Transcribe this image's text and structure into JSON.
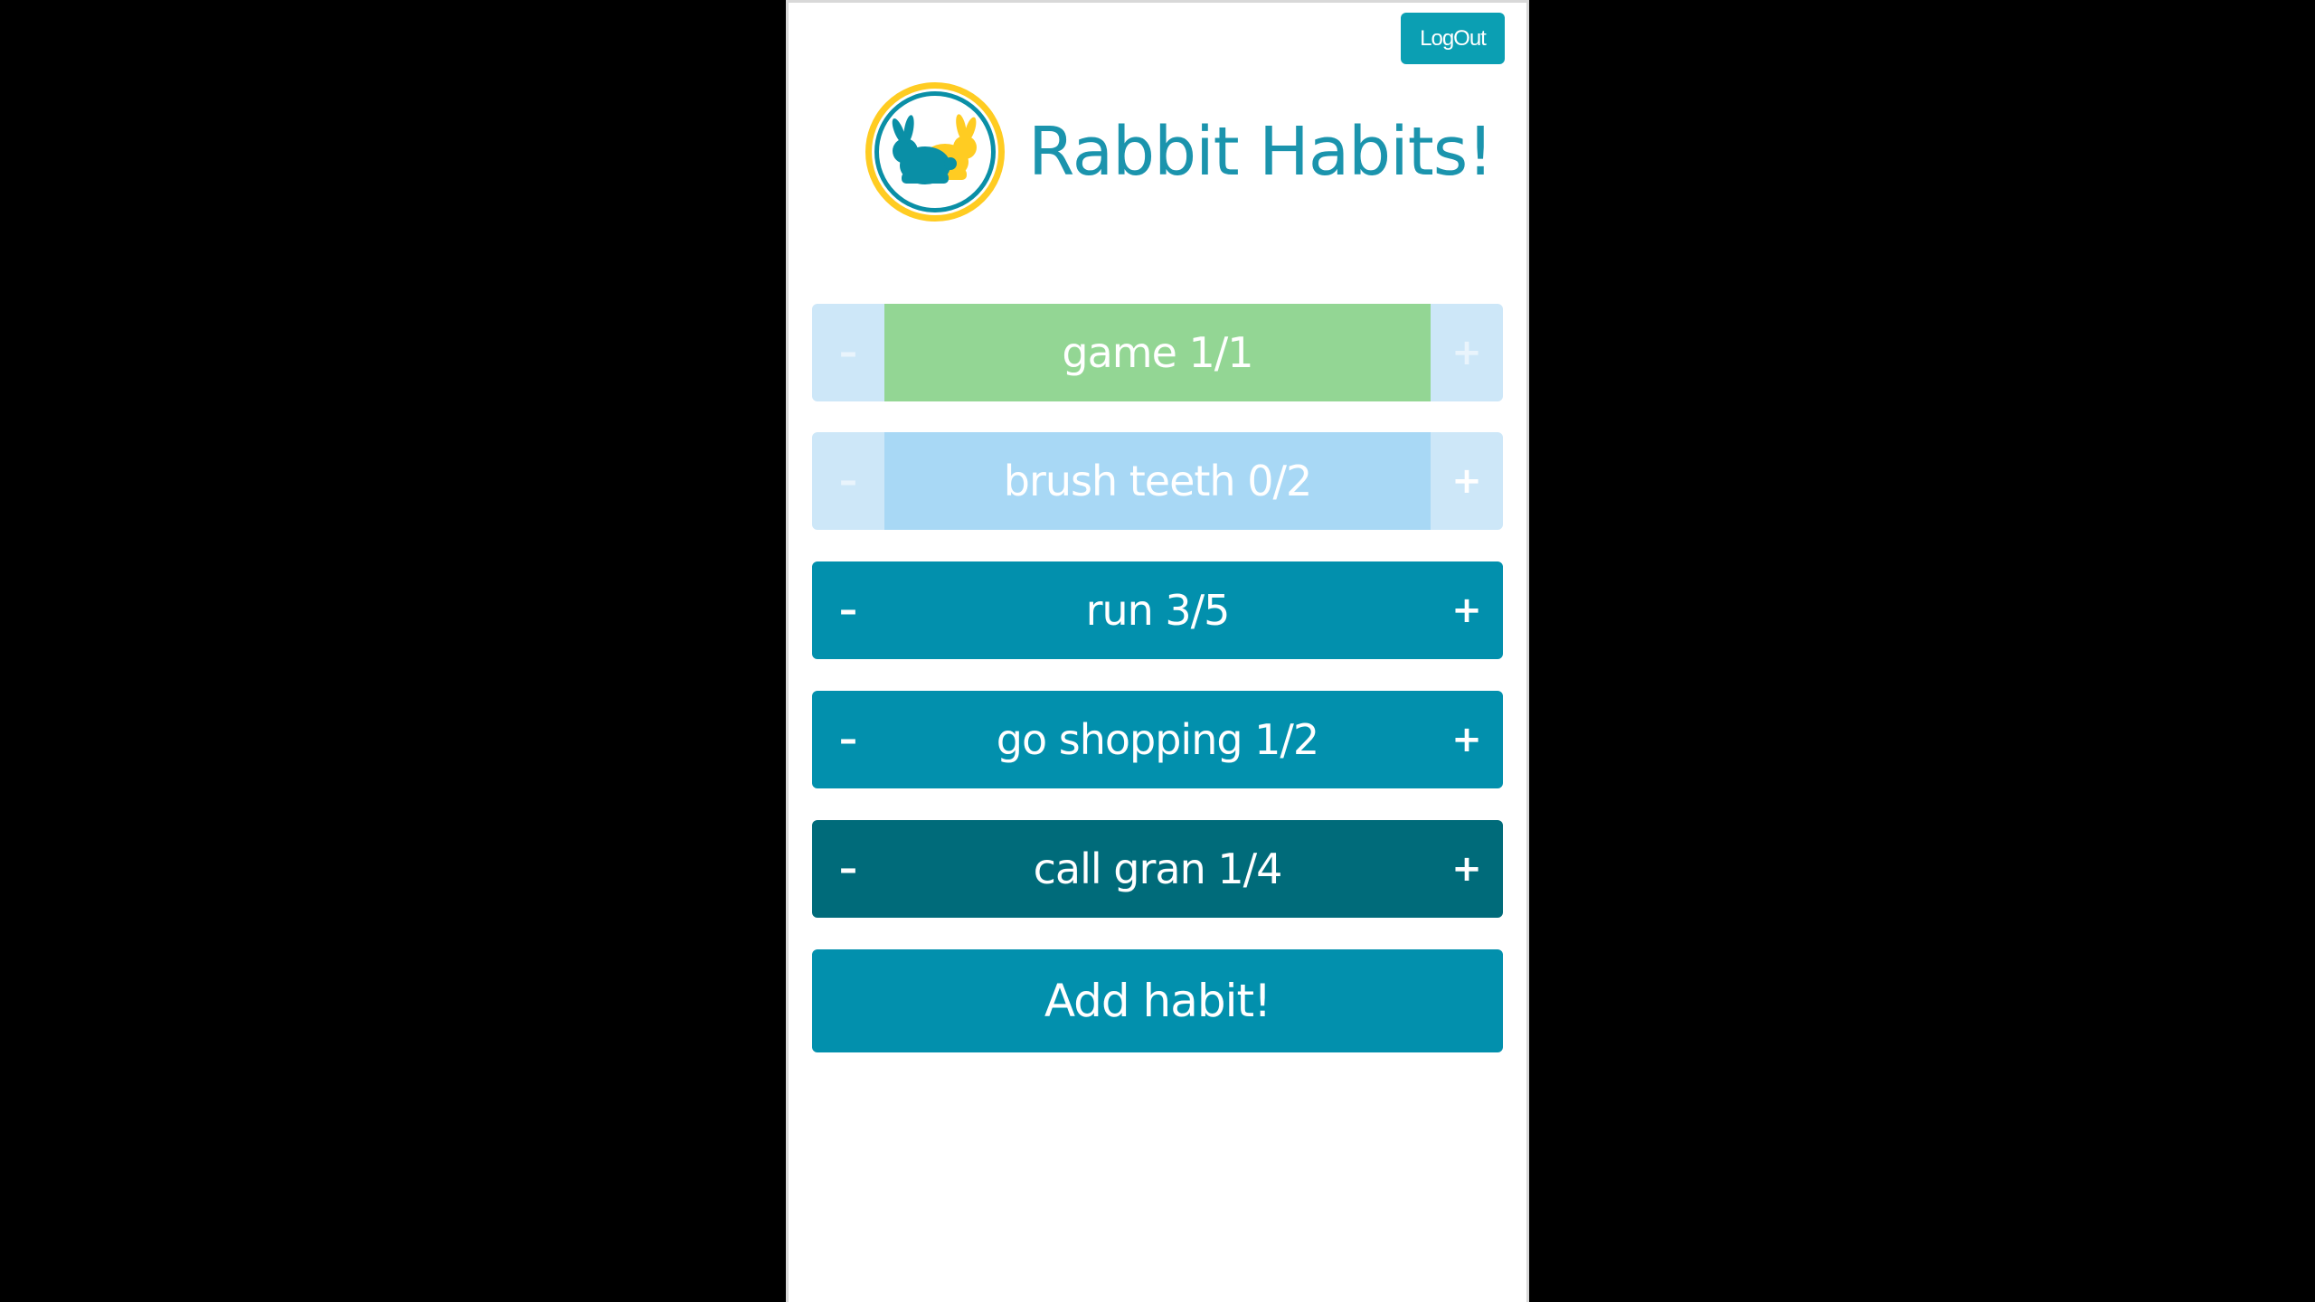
{
  "app": {
    "title": "Rabbit Habits!",
    "logout_label": "LogOut"
  },
  "habits": [
    {
      "label": "game 1/1",
      "minus": "–",
      "plus": "+",
      "side_color": "#cde7f8",
      "side_text": "#e3f1fb",
      "main_color": "#93d694"
    },
    {
      "label": "brush teeth 0/2",
      "minus": "–",
      "plus": "+",
      "side_color": "#cde7f8",
      "side_text": "#e3f1fb",
      "main_color": "#a8d8f5"
    },
    {
      "label": "run 3/5",
      "minus": "–",
      "plus": "+",
      "side_color": "#0290ad",
      "side_text": "#ffffff",
      "main_color": "#0290ad"
    },
    {
      "label": "go shopping 1/2",
      "minus": "–",
      "plus": "+",
      "side_color": "#0290ad",
      "side_text": "#ffffff",
      "main_color": "#0290ad"
    },
    {
      "label": "call gran 1/4",
      "minus": "–",
      "plus": "+",
      "side_color": "#006b7a",
      "side_text": "#ffffff",
      "main_color": "#006b7a"
    }
  ],
  "add_habit": {
    "label": "Add habit!",
    "color": "#0290ad"
  },
  "colors": {
    "logo_ring": "#ffcc22",
    "logo_inner_ring": "#0a8fa6",
    "rabbit_front": "#0a8fa6",
    "rabbit_back": "#ffcc22",
    "title": "#1b94ad",
    "logout_bg": "#0b9fb3"
  }
}
